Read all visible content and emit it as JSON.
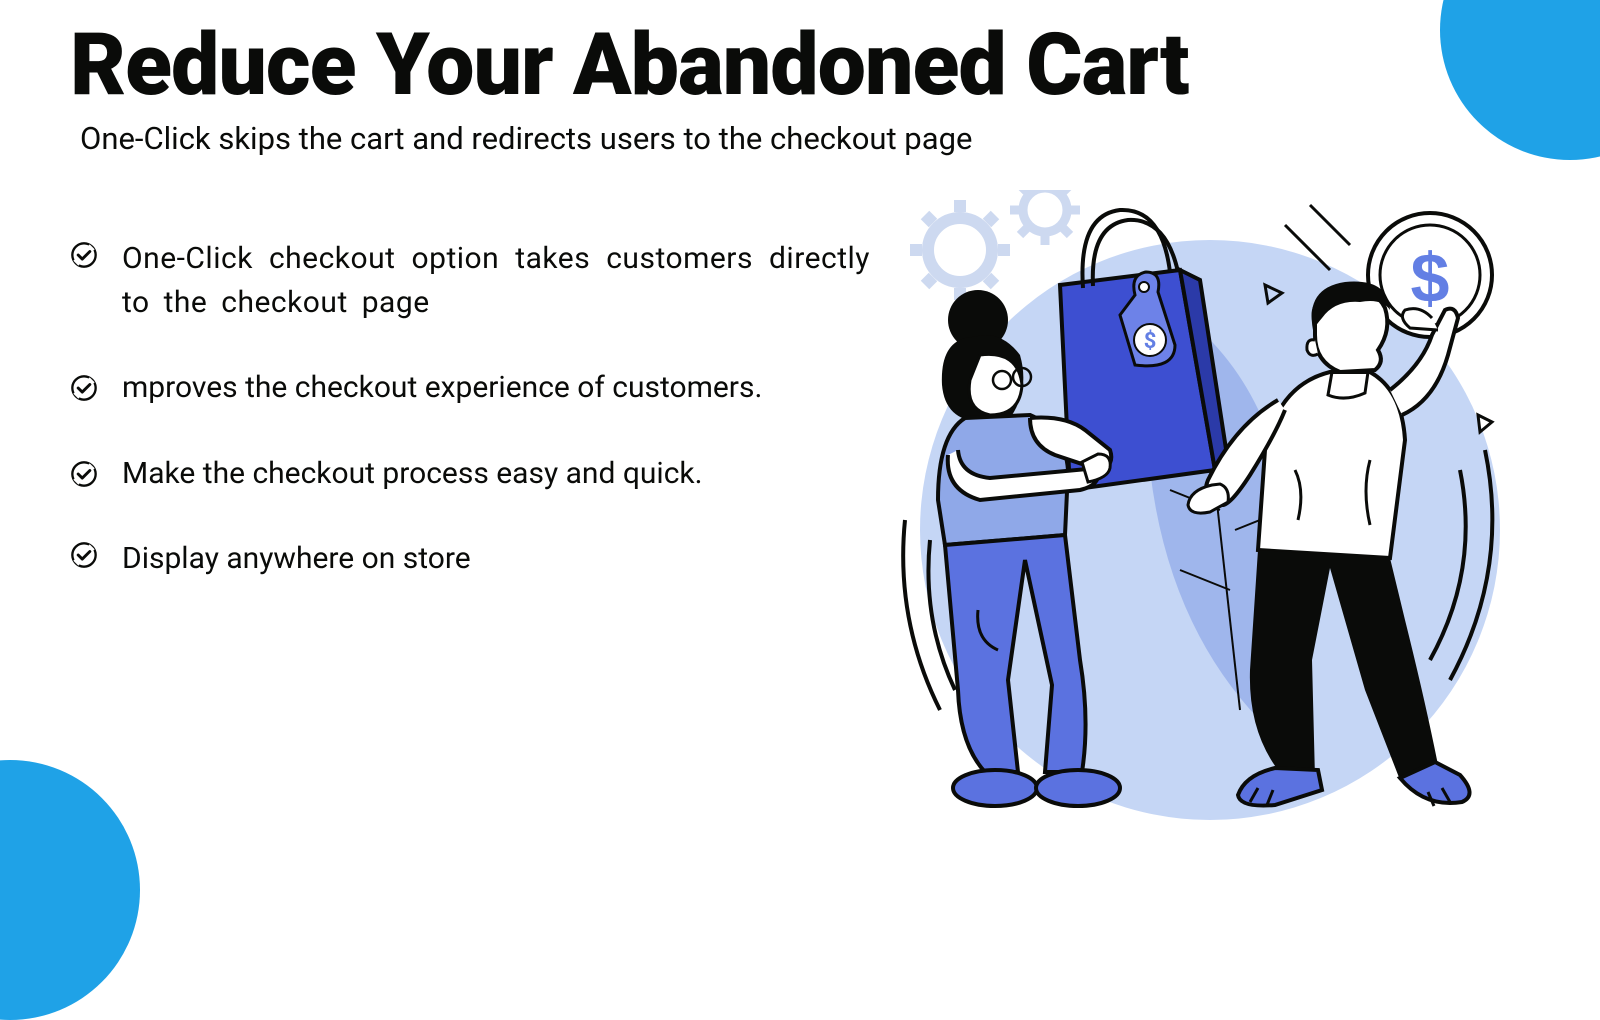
{
  "title": "Reduce Your Abandoned Cart",
  "subtitle": "One-Click skips the cart and redirects users to the checkout page",
  "features": [
    "One-Click checkout option takes customers directly to the checkout page",
    "mproves the checkout experience of customers.",
    "Make the checkout process easy and quick.",
    "Display anywhere on store"
  ],
  "colors": {
    "accent": "#1fa2e7",
    "illustration_blue": "#4c63d8",
    "illustration_light_blue": "#c5d6f5",
    "illustration_dark": "#0a0b09"
  }
}
